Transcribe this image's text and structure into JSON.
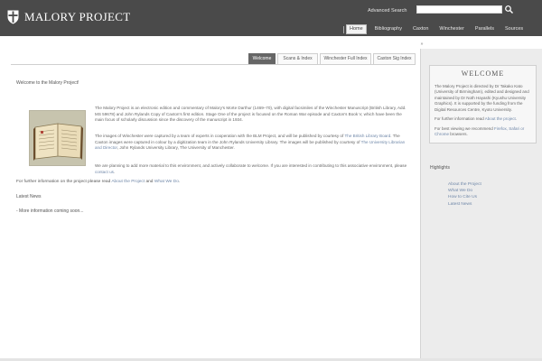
{
  "header": {
    "logo_text": "MALORY PROJECT",
    "advanced_search": "Advanced Search",
    "search": {
      "value": "",
      "placeholder": ""
    },
    "nav": [
      "Home",
      "Bibliography",
      "Caxton",
      "Winchester",
      "Parallels",
      "Sources"
    ],
    "active_nav": "Home"
  },
  "tabs": [
    "Welcome",
    "Scans & Index",
    "Winchester Full Index",
    "Caxton Sig Index"
  ],
  "active_tab": "Welcome",
  "main": {
    "welcome_line": "Welcome to the Malory Project!",
    "image_alt": "Winchester Manuscript",
    "p1": "The Malory Project is an electronic edition and commentary of Malory's Morte Darthur (1469–70), with digital facsimiles of the Winchester Manuscript (British Library, Add. MS 59678) and John Rylands Copy of Caxton's first edition. Stage One of the project is focused on the Roman War episode and Caxton's Book V, which have been the main focus of scholarly discussion since the discovery of the manuscript in 1934.",
    "p2_before": "The images of Winchester were captured by a team of experts in cooperation with the BLM Project, and will be published by courtesy of ",
    "p2_link1": "The British Library Board",
    "p2_mid": ". The Caxton images were captured in colour by a digitization team in the John Rylands University Library. The images will be published by courtesy of ",
    "p2_link2": "The University Librarian and Director",
    "p2_after": ", John Rylands University Library, The University of Manchester.",
    "p3_before": "We are planning to add more material to this environment, and actively collaborate to welcome. If you are interested in contributing to this associative environment, please ",
    "p3_link": "contact us",
    "p3_after": ".",
    "p4_before": "For further information on the project please read ",
    "p4_link1": "About the Project",
    "p4_mid": " and ",
    "p4_link2": "What We Do",
    "p4_after": ".",
    "latest_news": "Latest News",
    "more_info": "- More information coming soon..."
  },
  "sidebar": {
    "welcome_title": "WELCOME",
    "welcome_text": "The Malory Project is directed by Dr Takako Kato (University of Birmingham), edited and designed and maintained by Dr Noth Hayashi (Kyushu University Graphics). It is supported by the funding from the Digital Resources Centre, Kyoto University.",
    "info_before": "For further information read ",
    "info_link": "About the project",
    "info_after": ".",
    "browser_before": "For best viewing we recommend ",
    "browser_link": "Firefox, Safari or Chrome",
    "browser_after": " browsers.",
    "highlights_title": "Highlights",
    "highlights": [
      "About the Project",
      "What We Do",
      "How to Cite Us",
      "Latest News"
    ]
  },
  "colors": {
    "header_bg": "#4a4a4a",
    "link": "#6f87a8",
    "active_tab": "#666666",
    "sidebar_bg": "#ececec"
  }
}
